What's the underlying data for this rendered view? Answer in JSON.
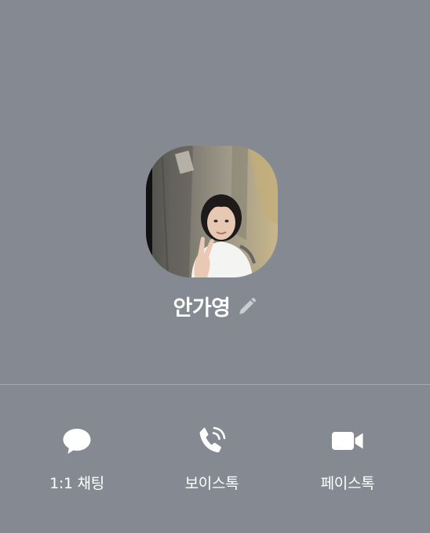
{
  "profile": {
    "name": "안가영"
  },
  "actions": [
    {
      "label": "1:1 채팅",
      "icon": "chat-bubble-icon"
    },
    {
      "label": "보이스톡",
      "icon": "voice-call-icon"
    },
    {
      "label": "페이스톡",
      "icon": "video-camera-icon"
    }
  ],
  "colors": {
    "background": "#858a92",
    "divider": "#a7abb1",
    "text": "#ffffff",
    "edit_icon": "#c9ccd1"
  }
}
